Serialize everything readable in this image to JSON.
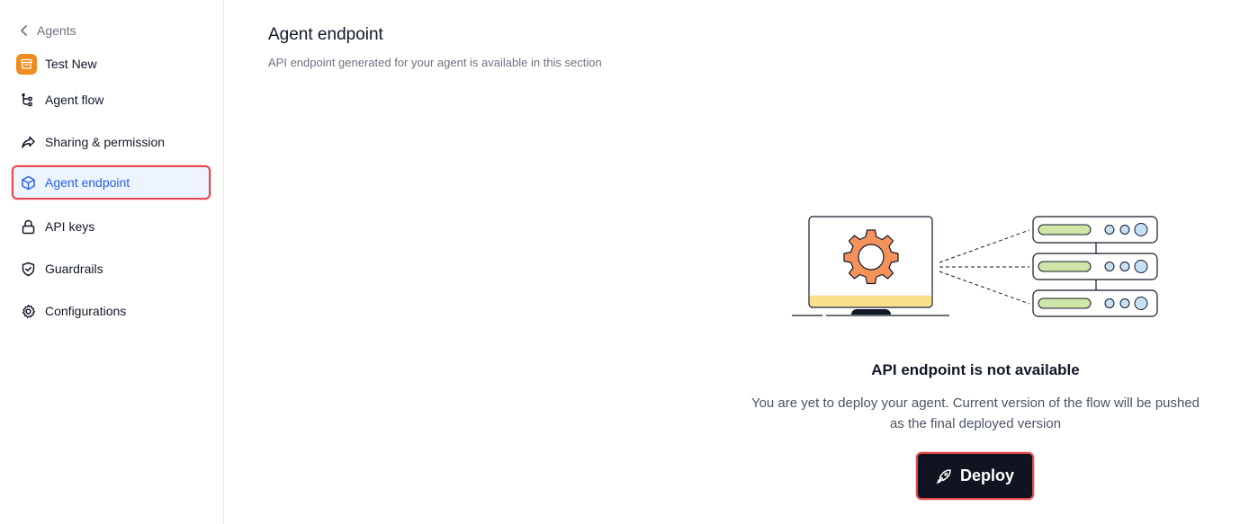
{
  "sidebar": {
    "back_label": "Agents",
    "agent_name": "Test New",
    "items": [
      {
        "label": "Agent flow",
        "icon": "flow-icon",
        "active": false
      },
      {
        "label": "Sharing & permission",
        "icon": "share-icon",
        "active": false
      },
      {
        "label": "Agent endpoint",
        "icon": "cube-icon",
        "active": true
      },
      {
        "label": "API keys",
        "icon": "lock-icon",
        "active": false
      },
      {
        "label": "Guardrails",
        "icon": "shield-check-icon",
        "active": false
      },
      {
        "label": "Configurations",
        "icon": "gear-icon",
        "active": false
      }
    ]
  },
  "main": {
    "title": "Agent endpoint",
    "subtitle": "API endpoint generated for your agent is available in this section",
    "empty_state": {
      "title": "API endpoint is not available",
      "description": "You are yet to deploy your agent. Current version of the flow will be pushed as the final deployed version",
      "button_label": "Deploy",
      "button_icon": "rocket-icon"
    }
  },
  "colors": {
    "accent": "#2563eb",
    "active_bg": "#eef4ff",
    "highlight_border": "#e5484d",
    "button_bg": "#0f1420",
    "avatar": "#f08b1f",
    "gear": "#f4925a",
    "server_bar": "#cfe6a8",
    "server_dot": "#c6e0f5",
    "monitor_base": "#fbe08a"
  }
}
